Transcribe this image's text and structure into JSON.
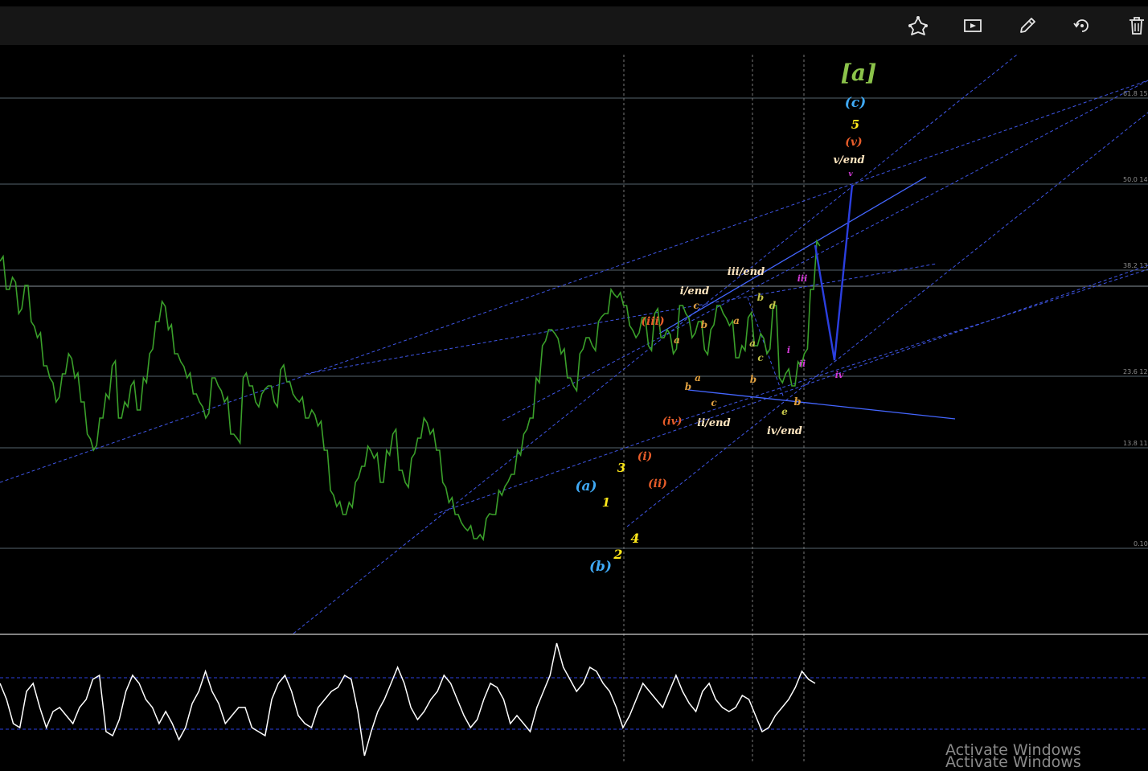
{
  "toolbar": {
    "icons": [
      "shapes-icon",
      "replay-icon",
      "pencil-icon",
      "rotate-icon",
      "trash-icon"
    ]
  },
  "colors": {
    "background": "#000000",
    "toolbar": "#161616",
    "price": "#3aa02a",
    "trendline": "#4466ff",
    "channel": "#3c5dff",
    "fib": "#5a6a78",
    "oscillator": "#ffffff"
  },
  "chart_data": {
    "type": "line",
    "title": "",
    "xlabel": "",
    "ylabel": "",
    "grid": false,
    "fib_levels": [
      "61.8 15",
      "50.0 14",
      "38.2 13",
      "23.6 12",
      "13.8 11",
      "0.10"
    ],
    "price_series": {
      "name": "",
      "values": [
        325,
        360,
        345,
        390,
        355,
        400,
        420,
        455,
        470,
        500,
        465,
        440,
        470,
        500,
        540,
        560,
        520,
        490,
        455,
        520,
        500,
        480,
        510,
        470,
        440,
        400,
        375,
        410,
        440,
        450,
        470,
        490,
        500,
        520,
        470,
        480,
        500,
        540,
        545,
        470,
        480,
        500,
        490,
        480,
        500,
        460,
        475,
        490,
        500,
        520,
        510,
        530,
        560,
        610,
        630,
        640,
        625,
        600,
        580,
        555,
        570,
        600,
        560,
        540,
        585,
        600,
        570,
        545,
        520,
        540,
        560,
        600,
        625,
        640,
        650,
        660,
        670,
        665,
        645,
        640,
        610,
        605,
        590,
        560,
        540,
        520,
        470,
        430,
        410,
        415,
        440,
        470,
        480,
        440,
        420,
        430,
        400,
        390,
        360,
        370,
        380,
        405,
        420,
        395,
        430,
        390,
        420,
        410,
        440,
        380,
        390,
        420,
        400,
        435,
        410,
        380,
        390,
        405,
        445,
        430,
        395,
        430,
        415,
        440,
        380,
        470,
        465,
        480,
        450,
        440,
        360,
        300
      ]
    },
    "oscillator_series": {
      "name": "",
      "values": [
        850,
        870,
        900,
        905,
        860,
        850,
        880,
        905,
        885,
        880,
        890,
        900,
        880,
        870,
        845,
        840,
        910,
        915,
        895,
        860,
        840,
        850,
        870,
        880,
        900,
        885,
        900,
        920,
        905,
        875,
        860,
        835,
        860,
        875,
        900,
        890,
        880,
        880,
        905,
        910,
        915,
        870,
        850,
        840,
        860,
        890,
        900,
        905,
        880,
        870,
        860,
        855,
        840,
        845,
        885,
        940,
        910,
        885,
        870,
        850,
        830,
        850,
        880,
        895,
        885,
        870,
        860,
        840,
        850,
        870,
        890,
        905,
        895,
        870,
        850,
        855,
        870,
        900,
        890,
        900,
        910,
        880,
        860,
        840,
        800,
        830,
        845,
        860,
        850,
        830,
        835,
        850,
        860,
        880,
        905,
        890,
        870,
        850,
        860,
        870,
        880,
        860,
        840,
        860,
        875,
        885,
        860,
        850,
        870,
        880,
        885,
        880,
        865,
        870,
        890,
        910,
        905,
        890,
        880,
        870,
        855,
        835,
        845,
        850
      ]
    },
    "wave_labels": [
      {
        "text": "[a]",
        "color": "#8bc34a"
      },
      {
        "text": "(c)",
        "color": "#3fa9f5"
      },
      {
        "text": "5",
        "color": "#ffe81a"
      },
      {
        "text": "(v)",
        "color": "#e85d2a"
      },
      {
        "text": "v/end",
        "color": "#ffe6c0"
      },
      {
        "text": "v",
        "color": "#d63bdb"
      },
      {
        "text": "iii/end",
        "color": "#ffe6c0"
      },
      {
        "text": "i/end",
        "color": "#ffe6c0"
      },
      {
        "text": "(iii)",
        "color": "#e85d2a"
      },
      {
        "text": "iii",
        "color": "#d63bdb"
      },
      {
        "text": "c",
        "color": "#e0a040"
      },
      {
        "text": "b",
        "color": "#e0a040"
      },
      {
        "text": "a",
        "color": "#e0a040"
      },
      {
        "text": "b",
        "color": "#c6c64a"
      },
      {
        "text": "d",
        "color": "#c6c64a"
      },
      {
        "text": "a",
        "color": "#c6c64a"
      },
      {
        "text": "c",
        "color": "#c6c64a"
      },
      {
        "text": "b",
        "color": "#e0a040"
      },
      {
        "text": "a",
        "color": "#e0a040"
      },
      {
        "text": "c",
        "color": "#e0a040"
      },
      {
        "text": "a",
        "color": "#e0a040"
      },
      {
        "text": "b",
        "color": "#e0a040"
      },
      {
        "text": "i",
        "color": "#d63bdb"
      },
      {
        "text": "ii",
        "color": "#d63bdb"
      },
      {
        "text": "iv",
        "color": "#d63bdb"
      },
      {
        "text": "e",
        "color": "#c6c64a"
      },
      {
        "text": "b",
        "color": "#e0a040"
      },
      {
        "text": "iv/end",
        "color": "#ffe6c0"
      },
      {
        "text": "ii/end",
        "color": "#ffe6c0"
      },
      {
        "text": "(iv)",
        "color": "#e85d2a"
      },
      {
        "text": "(i)",
        "color": "#e85d2a"
      },
      {
        "text": "(ii)",
        "color": "#e85d2a"
      },
      {
        "text": "3",
        "color": "#ffe81a"
      },
      {
        "text": "(a)",
        "color": "#3fa9f5"
      },
      {
        "text": "1",
        "color": "#ffe81a"
      },
      {
        "text": "4",
        "color": "#ffe81a"
      },
      {
        "text": "2",
        "color": "#ffe81a"
      },
      {
        "text": "(b)",
        "color": "#3fa9f5"
      }
    ]
  },
  "watermark": {
    "line1": "Activate Windows",
    "line2": "Activate Windows"
  }
}
